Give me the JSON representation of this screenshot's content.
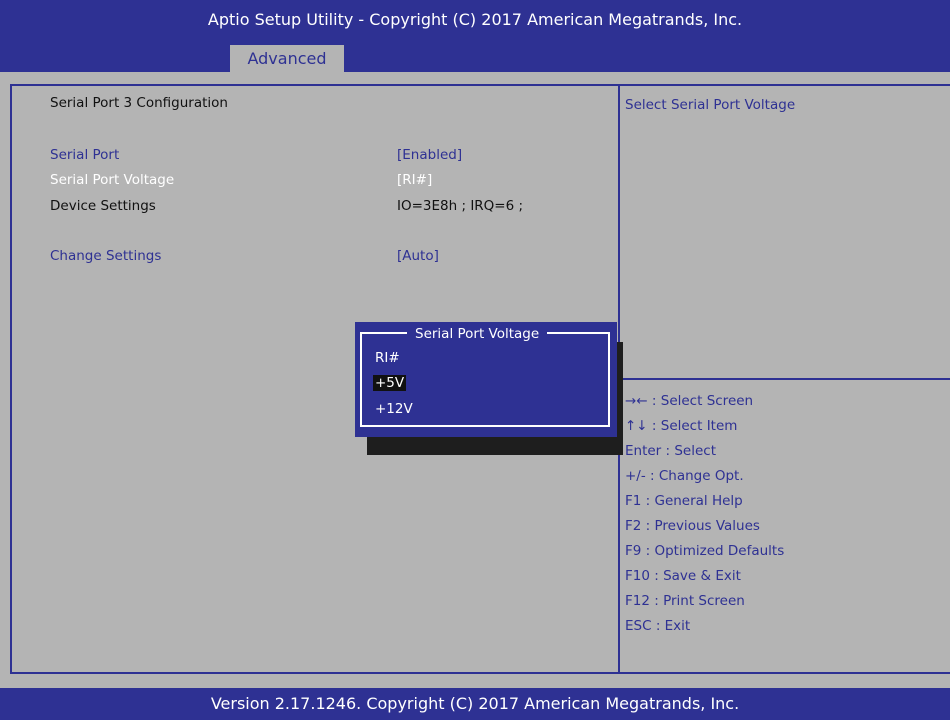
{
  "header": {
    "title": "Aptio Setup Utility - Copyright (C) 2017 American Megatrands, Inc.",
    "active_tab": "Advanced"
  },
  "main": {
    "section_title": "Serial Port 3 Configuration",
    "settings": [
      {
        "label": "Serial Port",
        "value": "[Enabled]"
      },
      {
        "label": "Serial Port Voltage",
        "value": "[RI#]"
      },
      {
        "label": "Device Settings",
        "value": "IO=3E8h ;  IRQ=6 ;"
      },
      {
        "label": "Change Settings",
        "value": "[Auto]"
      }
    ]
  },
  "help_panel": {
    "description": "Select Serial Port Voltage",
    "keys": [
      "→← : Select Screen",
      "↑↓ : Select Item",
      "Enter : Select",
      "+/- : Change Opt.",
      "F1 : General Help",
      "F2 : Previous Values",
      "F9 : Optimized Defaults",
      "F10 : Save & Exit",
      "F12 : Print Screen",
      "ESC : Exit"
    ]
  },
  "popup": {
    "title": "Serial Port Voltage",
    "options": [
      "RI#",
      "+5V",
      "+12V"
    ],
    "selected": "+5V"
  },
  "footer": {
    "text": "Version 2.17.1246. Copyright (C) 2017 American Megatrands, Inc."
  },
  "colors": {
    "bios_blue": "#2e3193",
    "background_gray": "#b4b4b4",
    "highlight_white": "#ffffff"
  }
}
